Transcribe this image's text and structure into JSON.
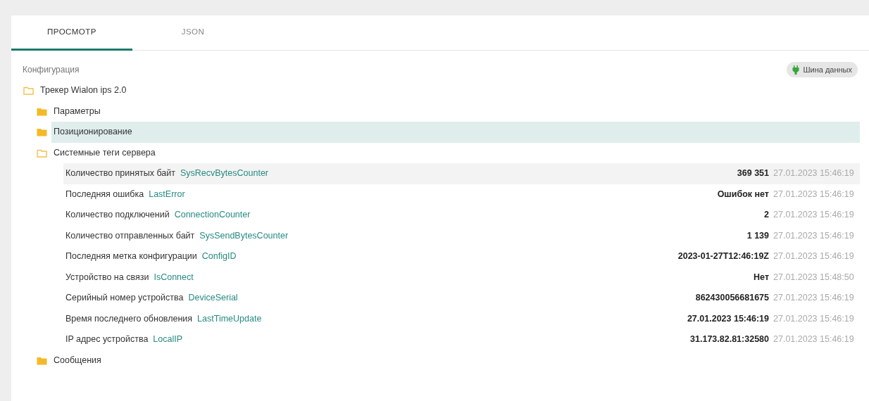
{
  "tabs": [
    {
      "label": "ПРОСМОТР",
      "selected": true
    },
    {
      "label": "JSON",
      "selected": false
    }
  ],
  "header": {
    "title": "Конфигурация",
    "bus_button": "Шина данных"
  },
  "tree": [
    {
      "kind": "folder",
      "label": "Трекер Wialon ips 2.0",
      "expanded": true,
      "selected": false,
      "children": [
        {
          "kind": "folder",
          "label": "Параметры",
          "expanded": false,
          "selected": false
        },
        {
          "kind": "folder",
          "label": "Позиционирование",
          "expanded": false,
          "selected": true
        },
        {
          "kind": "folder",
          "label": "Системные теги сервера",
          "expanded": true,
          "selected": false,
          "children": [
            {
              "kind": "tag",
              "label": "Количество принятых байт",
              "tag": "SysRecvBytesCounter",
              "value": "369 351",
              "time": "27.01.2023 15:46:19",
              "selected": false,
              "hovered": true
            },
            {
              "kind": "tag",
              "label": "Последняя ошибка",
              "tag": "LastError",
              "value": "Ошибок нет",
              "time": "27.01.2023 15:46:19",
              "selected": false,
              "hovered": false
            },
            {
              "kind": "tag",
              "label": "Количество подключений",
              "tag": "ConnectionCounter",
              "value": "2",
              "time": "27.01.2023 15:46:19",
              "selected": false,
              "hovered": false
            },
            {
              "kind": "tag",
              "label": "Количество отправленных байт",
              "tag": "SysSendBytesCounter",
              "value": "1 139",
              "time": "27.01.2023 15:46:19",
              "selected": false,
              "hovered": false
            },
            {
              "kind": "tag",
              "label": "Последняя метка конфигурации",
              "tag": "ConfigID",
              "value": "2023-01-27T12:46:19Z",
              "time": "27.01.2023 15:46:19",
              "selected": false,
              "hovered": false
            },
            {
              "kind": "tag",
              "label": "Устройство на связи",
              "tag": "IsConnect",
              "value": "Нет",
              "time": "27.01.2023 15:48:50",
              "selected": false,
              "hovered": false
            },
            {
              "kind": "tag",
              "label": "Серийный номер устройства",
              "tag": "DeviceSerial",
              "value": "862430056681675",
              "time": "27.01.2023 15:46:19",
              "selected": false,
              "hovered": false
            },
            {
              "kind": "tag",
              "label": "Время последнего обновления",
              "tag": "LastTimeUpdate",
              "value": "27.01.2023 15:46:19",
              "time": "27.01.2023 15:46:19",
              "selected": false,
              "hovered": false
            },
            {
              "kind": "tag",
              "label": "IP адрес устройства",
              "tag": "LocalIP",
              "value": "31.173.82.81:32580",
              "time": "27.01.2023 15:46:19",
              "selected": false,
              "hovered": false
            }
          ]
        },
        {
          "kind": "folder",
          "label": "Сообщения",
          "expanded": false,
          "selected": false
        }
      ]
    }
  ]
}
